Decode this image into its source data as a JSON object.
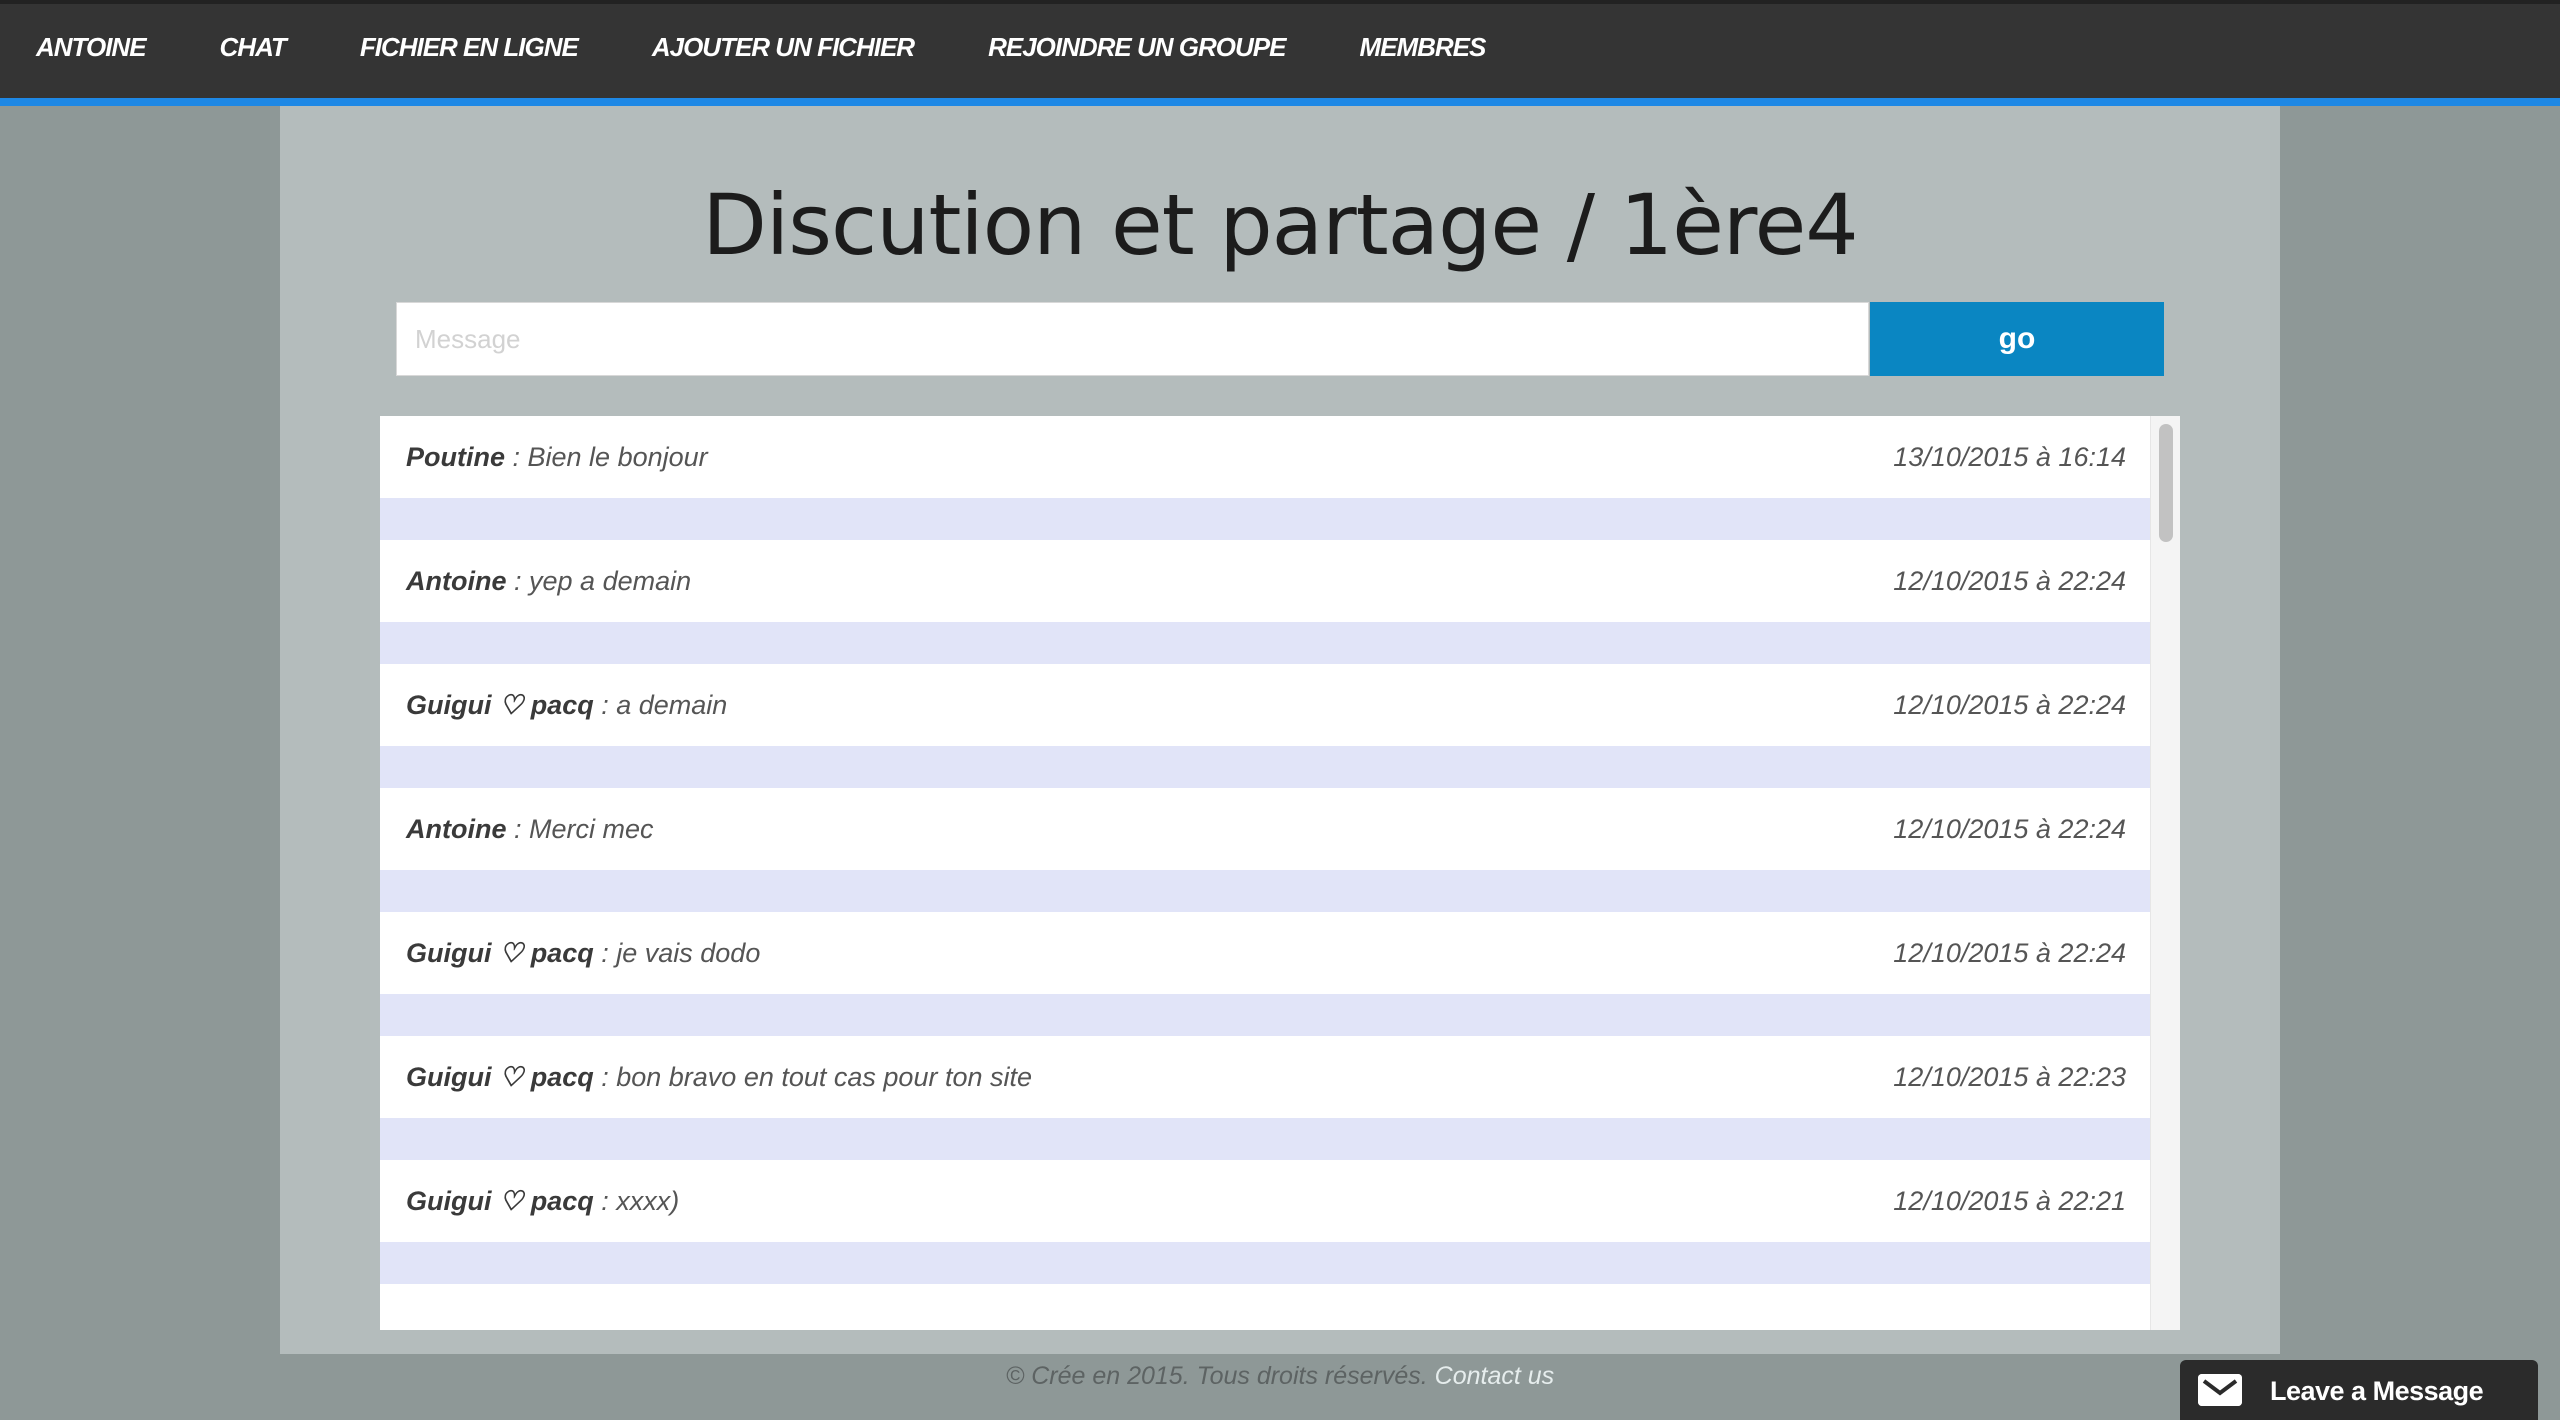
{
  "nav": {
    "items": [
      {
        "label": "ANTOINE"
      },
      {
        "label": "CHAT"
      },
      {
        "label": "FICHIER EN LIGNE"
      },
      {
        "label": "AJOUTER UN FICHIER"
      },
      {
        "label": "REJOINDRE UN GROUPE"
      },
      {
        "label": "MEMBRES"
      }
    ]
  },
  "main": {
    "title": "Discution et partage / 1ère4",
    "message_input": {
      "placeholder": "Message",
      "value": ""
    },
    "submit_label": "go"
  },
  "chat": {
    "separator": " : ",
    "messages": [
      {
        "author": "Poutine",
        "text": "Bien le bonjour",
        "time": "13/10/2015 à 16:14"
      },
      {
        "author": "Antoine",
        "text": "yep a demain",
        "time": "12/10/2015 à 22:24"
      },
      {
        "author": "Guigui ♡ pacq",
        "text": "a demain",
        "time": "12/10/2015 à 22:24"
      },
      {
        "author": "Antoine",
        "text": "Merci mec",
        "time": "12/10/2015 à 22:24"
      },
      {
        "author": "Guigui ♡ pacq",
        "text": "je vais dodo",
        "time": "12/10/2015 à 22:24"
      },
      {
        "author": "Guigui ♡ pacq",
        "text": "bon bravo en tout cas pour ton site",
        "time": "12/10/2015 à 22:23"
      },
      {
        "author": "Guigui ♡ pacq",
        "text": "xxxx)",
        "time": "12/10/2015 à 22:21"
      }
    ]
  },
  "footer": {
    "text": "© Crée en 2015. Tous droits réservés.",
    "link": "Contact us"
  },
  "widget": {
    "label": "Leave a Message",
    "icon": "mail-icon"
  },
  "colors": {
    "nav_bg": "#343434",
    "nav_accent": "#1e88e5",
    "button_bg": "#0a86c2",
    "row_alt": "#e1e4f8"
  }
}
